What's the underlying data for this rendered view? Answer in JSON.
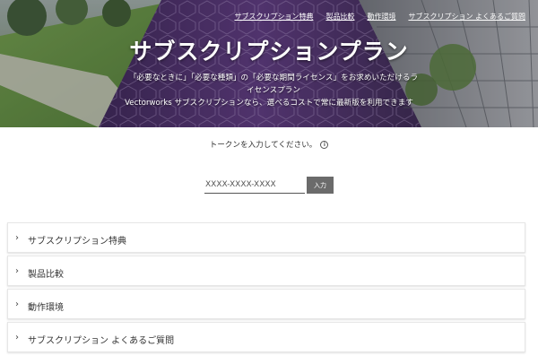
{
  "hero": {
    "nav": [
      {
        "label": "サブスクリプション特典"
      },
      {
        "label": "製品比較"
      },
      {
        "label": "動作環境"
      },
      {
        "label": "サブスクリプション よくあるご質問"
      }
    ],
    "title": "サブスクリプションプラン",
    "subtitle_line1": "「必要なときに」「必要な種類」の「必要な期間ライセンス」をお求めいただけるライセンスプラン",
    "subtitle_line2": "Vectorworks サブスクリプションなら、選べるコストで常に最新版を利用できます"
  },
  "token": {
    "prompt": "トークンを入力してください。",
    "info_icon": "info-circle-icon",
    "placeholder": "XXXX-XXXX-XXXX",
    "button_label": "入力"
  },
  "accordion": {
    "chevron_icon": "chevron-right-icon",
    "items": [
      {
        "label": "サブスクリプション特典"
      },
      {
        "label": "製品比較"
      },
      {
        "label": "動作環境"
      },
      {
        "label": "サブスクリプション よくあるご質問"
      }
    ]
  },
  "colors": {
    "hero_purple": "#4a2d63",
    "button_gray": "#6b6b6b"
  }
}
